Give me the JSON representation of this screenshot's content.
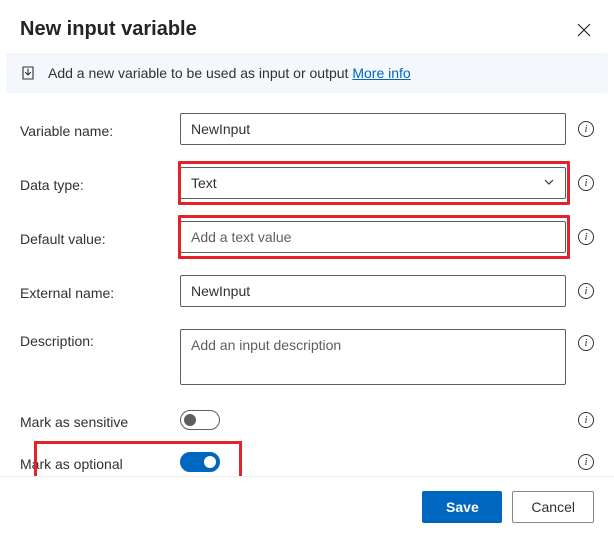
{
  "dialog": {
    "title": "New input variable"
  },
  "banner": {
    "text": "Add a new variable to be used as input or output ",
    "link_label": "More info"
  },
  "fields": {
    "variable_name": {
      "label": "Variable name:",
      "value": "NewInput"
    },
    "data_type": {
      "label": "Data type:",
      "value": "Text"
    },
    "default_value": {
      "label": "Default value:",
      "value": "",
      "placeholder": "Add a text value"
    },
    "external_name": {
      "label": "External name:",
      "value": "NewInput"
    },
    "description": {
      "label": "Description:",
      "value": "",
      "placeholder": "Add an input description"
    },
    "sensitive": {
      "label": "Mark as sensitive",
      "on": false
    },
    "optional": {
      "label": "Mark as optional",
      "on": true
    }
  },
  "buttons": {
    "save": "Save",
    "cancel": "Cancel"
  },
  "icons": {
    "info_glyph": "i"
  }
}
